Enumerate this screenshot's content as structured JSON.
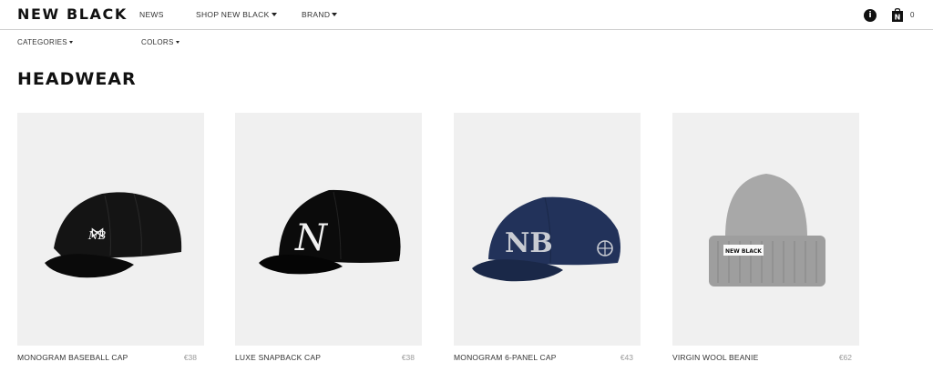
{
  "header": {
    "logo": "NEW BLACK",
    "nav": [
      {
        "label": "NEWS"
      },
      {
        "label": "SHOP NEW BLACK"
      },
      {
        "label": "BRAND"
      }
    ],
    "info_icon": "info-icon",
    "bag_icon": "shopping-bag-icon",
    "info_glyph": "i",
    "bag_glyph": "N",
    "bag_count": "0"
  },
  "subnav": [
    {
      "label": "CATEGORIES"
    },
    {
      "label": "COLORS"
    }
  ],
  "page": {
    "title": "HEADWEAR"
  },
  "products": [
    {
      "name": "MONOGRAM BASEBALL CAP",
      "price": "€38",
      "color": "#141414"
    },
    {
      "name": "LUXE SNAPBACK CAP",
      "price": "€38",
      "color": "#0b0b0b"
    },
    {
      "name": "MONOGRAM 6-PANEL CAP",
      "price": "€43",
      "color": "#22325a"
    },
    {
      "name": "VIRGIN WOOL BEANIE",
      "price": "€62",
      "color": "#a3a3a3",
      "tag": "NEW BLACK"
    }
  ]
}
